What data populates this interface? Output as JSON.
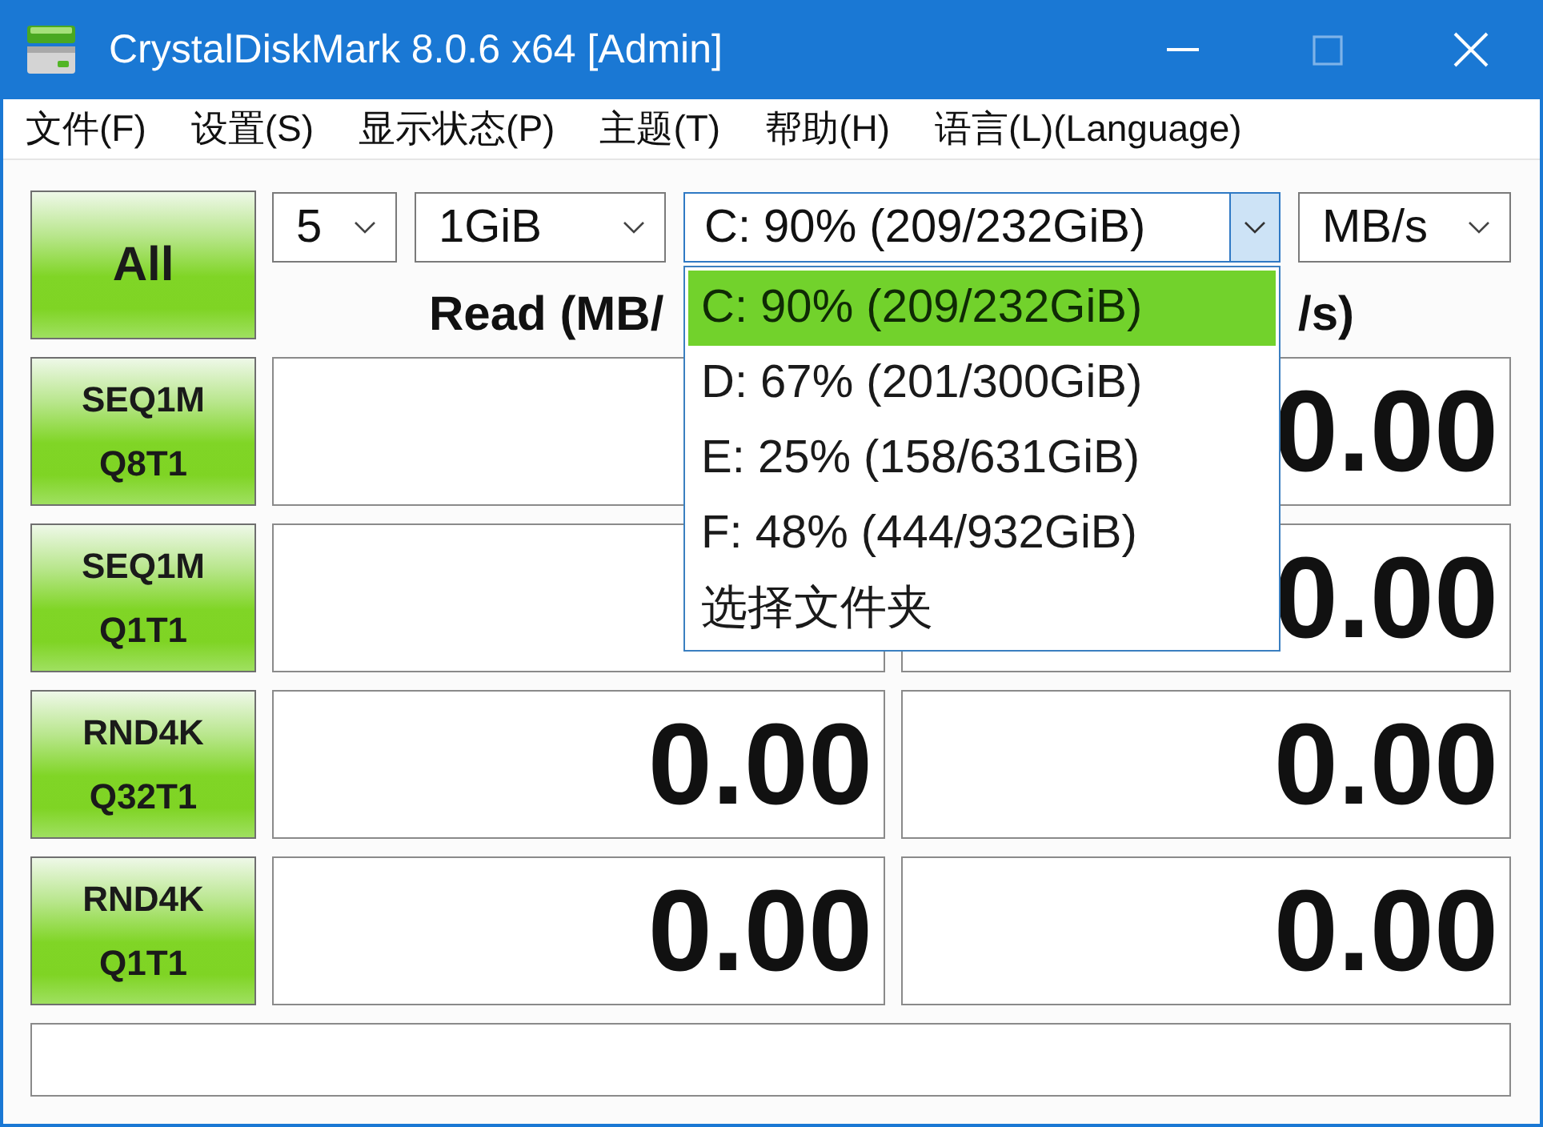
{
  "window": {
    "title": "CrystalDiskMark 8.0.6 x64 [Admin]",
    "controls": [
      {
        "kind": "minimize",
        "disabled": false
      },
      {
        "kind": "maximize",
        "disabled": true
      },
      {
        "kind": "close",
        "disabled": false
      }
    ]
  },
  "menu": [
    {
      "label": "文件(F)"
    },
    {
      "label": "设置(S)"
    },
    {
      "label": "显示状态(P)"
    },
    {
      "label": "主题(T)"
    },
    {
      "label": "帮助(H)"
    },
    {
      "label": "语言(L)(Language)"
    }
  ],
  "all_button": {
    "label": "All"
  },
  "selectors": [
    {
      "kind": "count",
      "value": "5"
    },
    {
      "kind": "size",
      "value": "1GiB"
    },
    {
      "kind": "drive",
      "value": "C: 90% (209/232GiB)",
      "open": true,
      "options": [
        {
          "label": "C: 90% (209/232GiB)",
          "selected": true
        },
        {
          "label": "D: 67% (201/300GiB)",
          "selected": false
        },
        {
          "label": "E: 25% (158/631GiB)",
          "selected": false
        },
        {
          "label": "F: 48% (444/932GiB)",
          "selected": false
        },
        {
          "label": "选择文件夹",
          "selected": false
        }
      ]
    },
    {
      "kind": "unit",
      "value": "MB/s"
    }
  ],
  "columns": [
    {
      "label": "Read (MB/"
    },
    {
      "label": "/s)"
    }
  ],
  "rows": [
    {
      "test": "SEQ1M\nQ8T1",
      "write": "0.00"
    },
    {
      "test": "SEQ1M\nQ1T1",
      "write": "0.00"
    },
    {
      "test": "RND4K\nQ32T1",
      "read": "0.00",
      "write": "0.00"
    },
    {
      "test": "RND4K\nQ1T1",
      "read": "0.00",
      "write": "0.00"
    }
  ]
}
